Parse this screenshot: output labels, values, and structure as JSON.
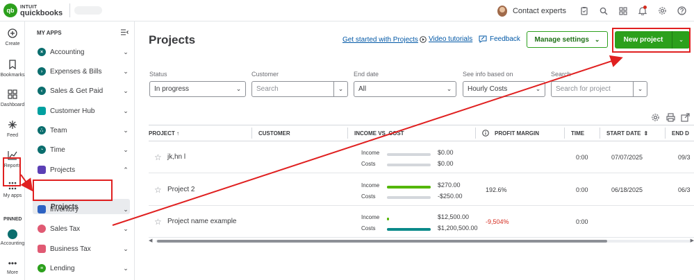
{
  "topbar": {
    "logo_mark": "qb",
    "logo_brand": "INTUIT",
    "logo_product": "quickbooks",
    "contact_label": "Contact experts",
    "icons": [
      "clipboard-icon",
      "search-icon",
      "apps-icon",
      "bell-icon",
      "gear-icon",
      "help-icon"
    ]
  },
  "rail": {
    "items": [
      {
        "label": "Create",
        "icon": "plus-circle-icon"
      },
      {
        "label": "Bookmarks",
        "icon": "bookmark-icon"
      },
      {
        "label": "Dashboard",
        "icon": "dashboard-icon"
      },
      {
        "label": "Feed",
        "icon": "sparkle-icon"
      },
      {
        "label": "Reports",
        "icon": "chart-icon"
      },
      {
        "label": "My apps",
        "icon": "grid-icon"
      }
    ],
    "pinned_label": "PINNED",
    "pinned_items": [
      {
        "label": "Accounting"
      }
    ],
    "more_label": "More"
  },
  "apps_panel": {
    "header": "MY APPS",
    "items": [
      {
        "label": "Accounting",
        "color": "#0b6e6e",
        "expanded": false
      },
      {
        "label": "Expenses & Bills",
        "color": "#0b6e6e",
        "expanded": false
      },
      {
        "label": "Sales & Get Paid",
        "color": "#0b6e6e",
        "expanded": false
      },
      {
        "label": "Customer Hub",
        "color": "#00a0a0",
        "expanded": false
      },
      {
        "label": "Team",
        "color": "#0b6e6e",
        "expanded": false
      },
      {
        "label": "Time",
        "color": "#0b6e6e",
        "expanded": false
      },
      {
        "label": "Projects",
        "color": "#5b3fb5",
        "expanded": true
      },
      {
        "label": "Inventory",
        "color": "#2d62c2",
        "expanded": false
      },
      {
        "label": "Sales Tax",
        "color": "#e05a73",
        "expanded": false
      },
      {
        "label": "Business Tax",
        "color": "#e05a73",
        "expanded": false
      },
      {
        "label": "Lending",
        "color": "#2ca01c",
        "expanded": false
      }
    ],
    "sub_item": "Projects"
  },
  "main": {
    "title": "Projects",
    "links": {
      "get_started": "Get started with Projects",
      "video": "Video tutorials",
      "feedback": "Feedback"
    },
    "manage_settings": "Manage settings",
    "new_project": "New project",
    "filters": {
      "status_label": "Status",
      "status_value": "In progress",
      "customer_label": "Customer",
      "customer_placeholder": "Search",
      "end_date_label": "End date",
      "end_date_value": "All",
      "info_label": "See info based on",
      "info_value": "Hourly Costs",
      "search_label": "Search",
      "search_placeholder": "Search for project"
    },
    "table": {
      "headers": {
        "project": "PROJECT ↑",
        "customer": "CUSTOMER",
        "income_cost": "INCOME VS. COST",
        "profit_margin": "PROFIT MARGIN",
        "time": "TIME",
        "start_date": "START DATE",
        "end_date": "END D"
      },
      "income_label": "Income",
      "costs_label": "Costs",
      "rows": [
        {
          "name": "jk,hn l",
          "income": "$0.00",
          "costs": "$0.00",
          "income_fill": 0,
          "costs_fill": 0,
          "margin": "",
          "time": "0:00",
          "start": "07/07/2025",
          "end": "09/3"
        },
        {
          "name": "Project 2",
          "income": "$270.00",
          "costs": "-$250.00",
          "income_fill": 1.0,
          "costs_fill": 0,
          "margin": "192.6%",
          "time": "0:00",
          "start": "06/18/2025",
          "end": "06/3"
        },
        {
          "name": "Project name example",
          "income": "$12,500.00",
          "costs": "$1,200,500.00",
          "income_fill": 0.04,
          "costs_fill": 1.0,
          "margin": "-9,504%",
          "time": "0:00",
          "start": "",
          "end": ""
        }
      ]
    }
  },
  "colors": {
    "brand_green": "#2ca01c",
    "income_bar": "#53b700",
    "costs_bar": "#0b8a8a",
    "negative": "#d52b1e",
    "annotation_red": "#e02020"
  }
}
